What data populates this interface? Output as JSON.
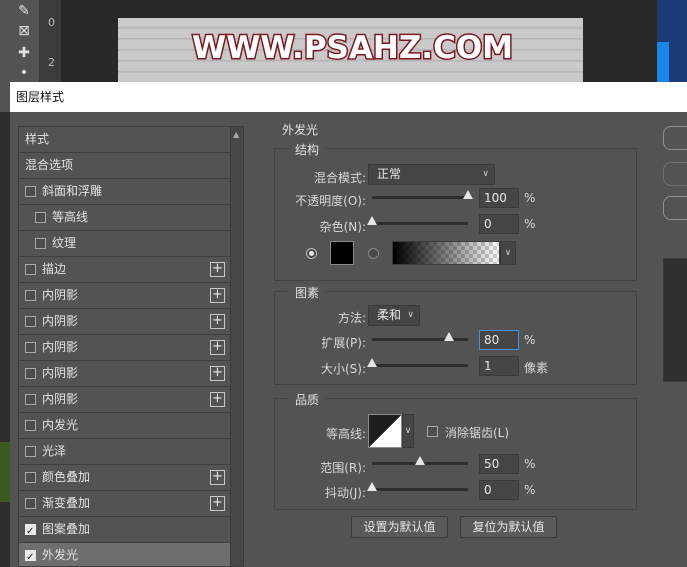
{
  "workspace": {
    "canvas_text": "WWW.PSAHZ.COM",
    "ruler_marks": [
      "0",
      "2"
    ]
  },
  "dialog": {
    "title": "图层样式",
    "styles_list": [
      {
        "label": "样式",
        "checkbox": false,
        "checked": false,
        "indent": 0,
        "plus": false,
        "selected": false
      },
      {
        "label": "混合选项",
        "checkbox": false,
        "checked": false,
        "indent": 0,
        "plus": false,
        "selected": false
      },
      {
        "label": "斜面和浮雕",
        "checkbox": true,
        "checked": false,
        "indent": 0,
        "plus": false,
        "selected": false
      },
      {
        "label": "等高线",
        "checkbox": true,
        "checked": false,
        "indent": 1,
        "plus": false,
        "selected": false
      },
      {
        "label": "纹理",
        "checkbox": true,
        "checked": false,
        "indent": 1,
        "plus": false,
        "selected": false
      },
      {
        "label": "描边",
        "checkbox": true,
        "checked": false,
        "indent": 0,
        "plus": true,
        "selected": false
      },
      {
        "label": "内阴影",
        "checkbox": true,
        "checked": false,
        "indent": 0,
        "plus": true,
        "selected": false
      },
      {
        "label": "内阴影",
        "checkbox": true,
        "checked": false,
        "indent": 0,
        "plus": true,
        "selected": false
      },
      {
        "label": "内阴影",
        "checkbox": true,
        "checked": false,
        "indent": 0,
        "plus": true,
        "selected": false
      },
      {
        "label": "内阴影",
        "checkbox": true,
        "checked": false,
        "indent": 0,
        "plus": true,
        "selected": false
      },
      {
        "label": "内阴影",
        "checkbox": true,
        "checked": false,
        "indent": 0,
        "plus": true,
        "selected": false
      },
      {
        "label": "内发光",
        "checkbox": true,
        "checked": false,
        "indent": 0,
        "plus": false,
        "selected": false
      },
      {
        "label": "光泽",
        "checkbox": true,
        "checked": false,
        "indent": 0,
        "plus": false,
        "selected": false
      },
      {
        "label": "颜色叠加",
        "checkbox": true,
        "checked": false,
        "indent": 0,
        "plus": true,
        "selected": false
      },
      {
        "label": "渐变叠加",
        "checkbox": true,
        "checked": false,
        "indent": 0,
        "plus": true,
        "selected": false
      },
      {
        "label": "图案叠加",
        "checkbox": true,
        "checked": true,
        "indent": 0,
        "plus": false,
        "selected": false
      },
      {
        "label": "外发光",
        "checkbox": true,
        "checked": true,
        "indent": 0,
        "plus": false,
        "selected": true
      }
    ],
    "section_title": "外发光",
    "structure": {
      "legend": "结构",
      "blend_mode_label": "混合模式:",
      "blend_mode_value": "正常",
      "opacity_label": "不透明度(O):",
      "opacity_value": "100",
      "opacity_level": 100,
      "noise_label": "杂色(N):",
      "noise_value": "0",
      "noise_level": 0,
      "percent": "%"
    },
    "elements": {
      "legend": "图素",
      "technique_label": "方法:",
      "technique_value": "柔和",
      "spread_label": "扩展(P):",
      "spread_value": "80",
      "spread_level": 80,
      "size_label": "大小(S):",
      "size_value": "1",
      "size_level": 0,
      "size_unit": "像素",
      "percent": "%"
    },
    "quality": {
      "legend": "品质",
      "contour_label": "等高线:",
      "antialias_label": "消除锯齿(L)",
      "range_label": "范围(R):",
      "range_value": "50",
      "range_level": 50,
      "jitter_label": "抖动(J):",
      "jitter_value": "0",
      "jitter_level": 0,
      "percent": "%"
    },
    "buttons": {
      "make_default": "设置为默认值",
      "reset_default": "复位为默认值"
    }
  },
  "colors": {
    "glow_color": "#000000",
    "accent_focus": "#4d90dc",
    "canvas_text_stroke": "#7a1820"
  }
}
